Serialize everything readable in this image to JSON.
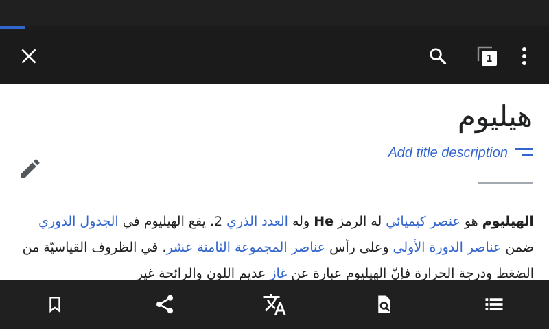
{
  "load_progress": 0.046,
  "toolbar": {
    "close_icon": "close-icon",
    "search_icon": "search-icon",
    "tabs_icon": "tabs-icon",
    "tab_count": "1",
    "overflow_icon": "more-vert-icon"
  },
  "article": {
    "title": "هيليوم",
    "title_description_prompt": "Add title description",
    "paragraph": [
      {
        "text": "الهيليوم",
        "kind": "bold"
      },
      {
        "text": " هو ",
        "kind": "text"
      },
      {
        "text": "عنصر كيميائي",
        "kind": "link"
      },
      {
        "text": " له الرمز ",
        "kind": "text"
      },
      {
        "text": "He",
        "kind": "bold"
      },
      {
        "text": " وله ",
        "kind": "text"
      },
      {
        "text": "العدد الذري",
        "kind": "link"
      },
      {
        "text": " 2. يقع الهيليوم في ",
        "kind": "text"
      },
      {
        "text": "الجدول الدوري",
        "kind": "link"
      },
      {
        "text": " ضمن ",
        "kind": "text"
      },
      {
        "text": "عناصر الدورة الأولى",
        "kind": "link"
      },
      {
        "text": " وعلى رأس ",
        "kind": "text"
      },
      {
        "text": "عناصر المجموعة الثامنة عشر",
        "kind": "link"
      },
      {
        "text": ". في الظروف القياسيّة من الضغط ودرجة الحرارة فإنّ الهيليوم عبارة عن ",
        "kind": "text"
      },
      {
        "text": "غاز",
        "kind": "link"
      },
      {
        "text": " عديم اللون والرائحة غير",
        "kind": "text"
      }
    ]
  },
  "bottom_bar": {
    "items": [
      {
        "name": "save-bookmark-icon"
      },
      {
        "name": "share-icon"
      },
      {
        "name": "translate-language-icon"
      },
      {
        "name": "find-in-page-icon"
      },
      {
        "name": "table-of-contents-icon"
      }
    ]
  },
  "colors": {
    "accent": "#3366cc",
    "toolbar_bg": "#1b1b1b",
    "bottom_bar_bg": "#202020",
    "text": "#202122"
  }
}
